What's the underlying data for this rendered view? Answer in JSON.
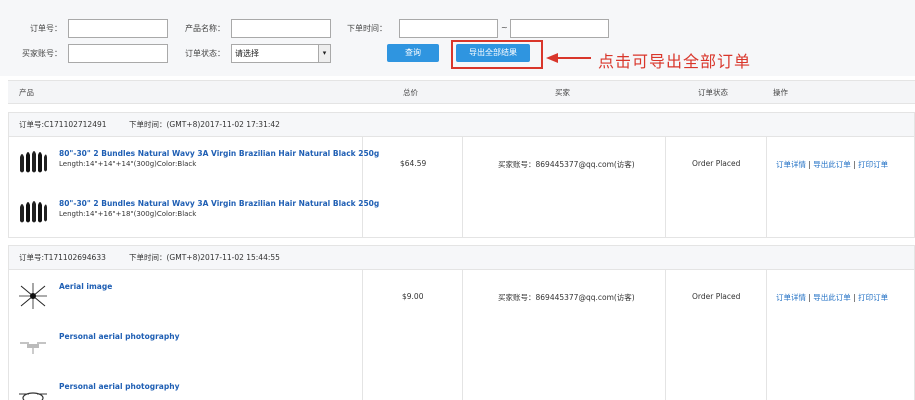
{
  "filters": {
    "order_no_label": "订单号：",
    "product_name_label": "产品名称：",
    "order_time_label": "下单时间：",
    "time_separator": "~",
    "buyer_account_label": "买家账号：",
    "order_status_label": "订单状态：",
    "order_status_value": "请选择",
    "query_button": "查询",
    "export_button": "导出全部结果"
  },
  "annotation": {
    "text": "点击可导出全部订单",
    "color": "#d9362b"
  },
  "table": {
    "headers": {
      "product": "产品",
      "total": "总价",
      "buyer": "买家",
      "status": "订单状态",
      "actions": "操作"
    }
  },
  "orders": [
    {
      "order_no": "订单号:C171102712491",
      "order_time": "下单时间：(GMT+8)2017-11-02 17:31:42",
      "total": "$64.59",
      "buyer": "买家账号：869445377@qq.com(访客)",
      "status": "Order Placed",
      "actions": [
        "订单详情",
        "导出此订单",
        "打印订单"
      ],
      "items": [
        {
          "name": "80\"-30\" 2 Bundles Natural Wavy 3A Virgin Brazilian Hair Natural Black 250g",
          "spec": "Length:14\"+14\"+14\"(300g)Color:Black",
          "icon": "hair-bundle-icon"
        },
        {
          "name": "80\"-30\" 2 Bundles Natural Wavy 3A Virgin Brazilian Hair Natural Black 250g",
          "spec": "Length:14\"+16\"+18\"(300g)Color:Black",
          "icon": "hair-bundle-icon"
        }
      ]
    },
    {
      "order_no": "订单号:T171102694633",
      "order_time": "下单时间：(GMT+8)2017-11-02 15:44:55",
      "total": "$9.00",
      "buyer": "买家账号：869445377@qq.com(访客)",
      "status": "Order Placed",
      "actions": [
        "订单详情",
        "导出此订单",
        "打印订单"
      ],
      "items": [
        {
          "name": "Aerial image",
          "icon": "drone-icon"
        },
        {
          "name": "Personal aerial photography",
          "icon": "drone-icon"
        },
        {
          "name": "Personal aerial photography",
          "icon": "drone-icon"
        }
      ]
    }
  ],
  "colors": {
    "accent": "#2f95e0",
    "link": "#1f6fc4",
    "annotation": "#d9362b"
  }
}
